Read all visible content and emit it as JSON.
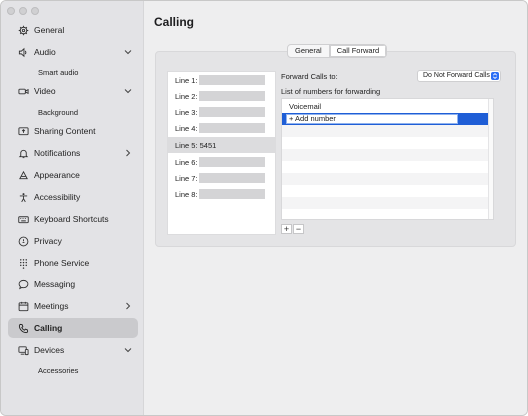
{
  "sidebar": {
    "items": [
      {
        "label": "General",
        "icon": "gear-icon"
      },
      {
        "label": "Audio",
        "icon": "speaker-icon",
        "expanded": true
      },
      {
        "label": "Smart audio"
      },
      {
        "label": "Video",
        "icon": "video-camera-icon",
        "expanded": true
      },
      {
        "label": "Background"
      },
      {
        "label": "Sharing Content",
        "icon": "share-screen-icon"
      },
      {
        "label": "Notifications",
        "icon": "bell-icon"
      },
      {
        "label": "Appearance",
        "icon": "appearance-icon"
      },
      {
        "label": "Accessibility",
        "icon": "accessibility-icon"
      },
      {
        "label": "Keyboard Shortcuts",
        "icon": "keyboard-icon"
      },
      {
        "label": "Privacy",
        "icon": "privacy-icon"
      },
      {
        "label": "Phone Service",
        "icon": "dialpad-icon"
      },
      {
        "label": "Messaging",
        "icon": "chat-bubble-icon"
      },
      {
        "label": "Meetings",
        "icon": "calendar-icon"
      },
      {
        "label": "Calling",
        "icon": "phone-icon",
        "active": true
      },
      {
        "label": "Devices",
        "icon": "devices-icon",
        "expanded": true
      },
      {
        "label": "Accessories"
      }
    ]
  },
  "main": {
    "title": "Calling",
    "tabs": [
      {
        "label": "General",
        "active": false
      },
      {
        "label": "Call Forward",
        "active": true
      }
    ],
    "lines": [
      {
        "label": "Line 1:",
        "value": ""
      },
      {
        "label": "Line 2:",
        "value": ""
      },
      {
        "label": "Line 3:",
        "value": ""
      },
      {
        "label": "Line 4:",
        "value": ""
      },
      {
        "label": "Line 5: 5451",
        "value": "",
        "selected": true
      },
      {
        "label": "Line 6:",
        "value": ""
      },
      {
        "label": "Line 7:",
        "value": ""
      },
      {
        "label": "Line 8:",
        "value": ""
      }
    ],
    "forward_label": "Forward Calls to:",
    "forward_select": "Do Not Forward Calls",
    "list_label": "List of numbers for forwarding",
    "numbers": [
      "Voicemail"
    ],
    "add_number_value": "+ Add number",
    "add_button": "+",
    "remove_button": "−"
  },
  "colors": {
    "accent": "#1f5ed6",
    "sidebar_bg": "#e3e3e6",
    "active_item": "#cacacd"
  }
}
